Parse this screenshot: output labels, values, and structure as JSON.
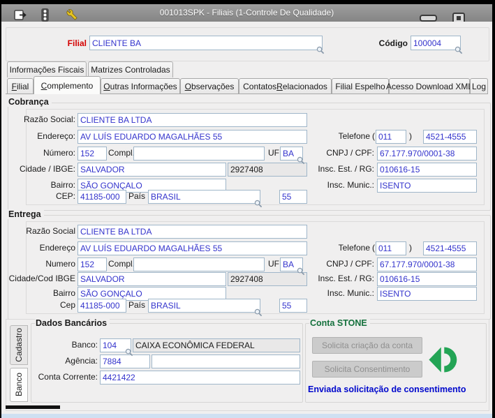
{
  "window": {
    "title": "001013SPK - Filiais (1-Controle De Qualidade)"
  },
  "header": {
    "filial_label": "Filial",
    "filial_value": "CLIENTE BA",
    "codigo_label": "Código",
    "codigo_value": "100004"
  },
  "tabs_top": [
    {
      "label": "Informações Fiscais"
    },
    {
      "label": "Matrizes Controladas"
    }
  ],
  "tabs_main": [
    {
      "label": "Filial",
      "accel": "F",
      "active": false
    },
    {
      "label": "Complemento",
      "accel": "C",
      "active": true
    },
    {
      "label": "Outras Informações",
      "accel": "O",
      "active": false
    },
    {
      "label": "Observações",
      "accel": "O",
      "active": false
    },
    {
      "label": "Contatos Relacionados",
      "accel": "R",
      "active": false
    },
    {
      "label": "Filial Espelho",
      "accel": "",
      "active": false
    },
    {
      "label": "Acesso Download XML",
      "accel": "",
      "active": false
    },
    {
      "label": "Log",
      "accel": "",
      "active": false
    }
  ],
  "cobranca": {
    "title": "Cobrança",
    "razao_label": "Razão Social:",
    "razao_value": "CLIENTE BA LTDA",
    "endereco_label": "Endereço:",
    "endereco_value": "AV LUÍS EDUARDO MAGALHÃES 55",
    "numero_label": "Número:",
    "numero_value": "152",
    "compl_label": "Compl.",
    "compl_value": "",
    "uf_label": "UF",
    "uf_value": "BA",
    "cidade_label": "Cidade / IBGE:",
    "cidade_value": "SALVADOR",
    "ibge_value": "2927408",
    "bairro_label": "Bairro:",
    "bairro_value": "SÃO GONÇALO",
    "cep_label": "CEP:",
    "cep_value": "41185-000",
    "pais_label": "País",
    "pais_value": "BRASIL",
    "pais_code": "55",
    "phone_label": "Telefone",
    "phone_open": "(",
    "phone_ddd": "011",
    "phone_close": ")",
    "phone_number": "4521-4555",
    "cnpj_label": "CNPJ / CPF:",
    "cnpj_value": "67.177.970/0001-38",
    "ie_label": "Insc. Est. / RG:",
    "ie_value": "010616-15",
    "im_label": "Insc. Munic.:",
    "im_value": "ISENTO"
  },
  "entrega": {
    "title": "Entrega",
    "razao_label": "Razão Social",
    "razao_value": "CLIENTE BA LTDA",
    "endereco_label": "Endereço",
    "endereco_value": "AV LUÍS EDUARDO MAGALHÃES 55",
    "numero_label": "Numero",
    "numero_value": "152",
    "compl_label": "Compl.",
    "compl_value": "",
    "uf_label": "UF",
    "uf_value": "BA",
    "cidade_label": "Cidade/Cod IBGE",
    "cidade_value": "SALVADOR",
    "ibge_value": "2927408",
    "bairro_label": "Bairro",
    "bairro_value": "SÃO GONÇALO",
    "cep_label": "Cep",
    "cep_value": "41185-000",
    "pais_label": "País",
    "pais_value": "BRASIL",
    "pais_code": "55",
    "phone_label": "Telefone",
    "phone_open": "(",
    "phone_ddd": "011",
    "phone_close": ")",
    "phone_number": "4521-4555",
    "cnpj_label": "CNPJ / CPF:",
    "cnpj_value": "67.177.970/0001-38",
    "ie_label": "Insc. Est. / RG:",
    "ie_value": "010616-15",
    "im_label": "Insc. Munic.:",
    "im_value": "ISENTO"
  },
  "side_tabs": [
    {
      "label": "Cadastro",
      "active": false
    },
    {
      "label": "Banco",
      "active": true
    }
  ],
  "banco": {
    "title": "Dados Bancários",
    "banco_label": "Banco:",
    "banco_code": "104",
    "banco_name": "CAIXA ECONÔMICA FEDERAL",
    "agencia_label": "Agência:",
    "agencia_value": "7884",
    "agencia_extra": "",
    "conta_label": "Conta Corrente:",
    "conta_value": "4421422"
  },
  "stone": {
    "title": "Conta STONE",
    "btn_create": "Solicita criação da conta",
    "btn_consent": "Solicita Consentimento",
    "status": "Enviada solicitação de consentimento"
  },
  "colors": {
    "field_text_blue": "#3333cc",
    "filial_label_red": "#d40000",
    "stone_title_green": "#15713d",
    "stone_logo_green": "#23a455",
    "status_text_blue": "#0008cc",
    "titlebar_gray": "#8e8e8e"
  }
}
